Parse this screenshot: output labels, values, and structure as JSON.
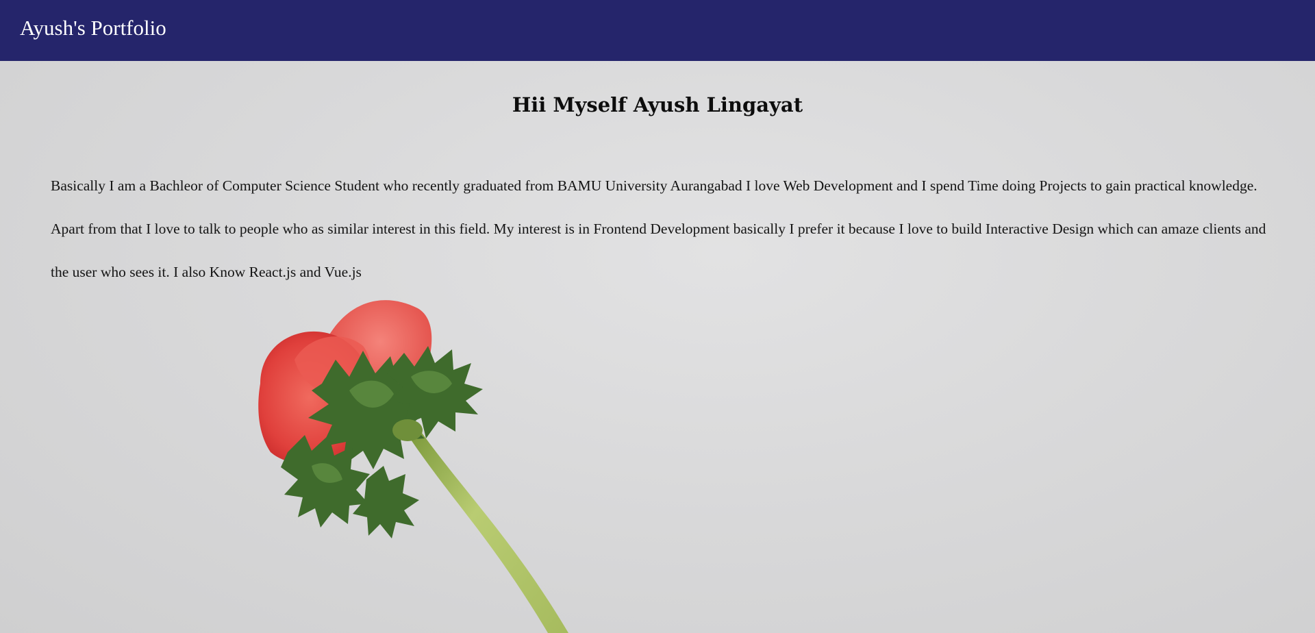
{
  "header": {
    "brand": "Ayush's Portfolio"
  },
  "main": {
    "heading": "Hii Myself Ayush Lingayat",
    "intro": "Basically I am a Bachleor of Computer Science Student who recently graduated from BAMU University Aurangabad I love Web Development and I spend Time doing Projects to gain practical knowledge. Apart from that I love to talk to people who as similar interest in this field. My interest is in Frontend Development basically I prefer it because I love to build Interactive Design which can amaze clients and the user who sees it. I also Know React.js and Vue.js"
  },
  "colors": {
    "navbar": "#25256b",
    "background": "#dcdcdd",
    "petal": "#e0403c",
    "leaf": "#3f6b2c",
    "stem": "#a9c160"
  },
  "icons": {
    "illustration": "red-flower-image"
  }
}
